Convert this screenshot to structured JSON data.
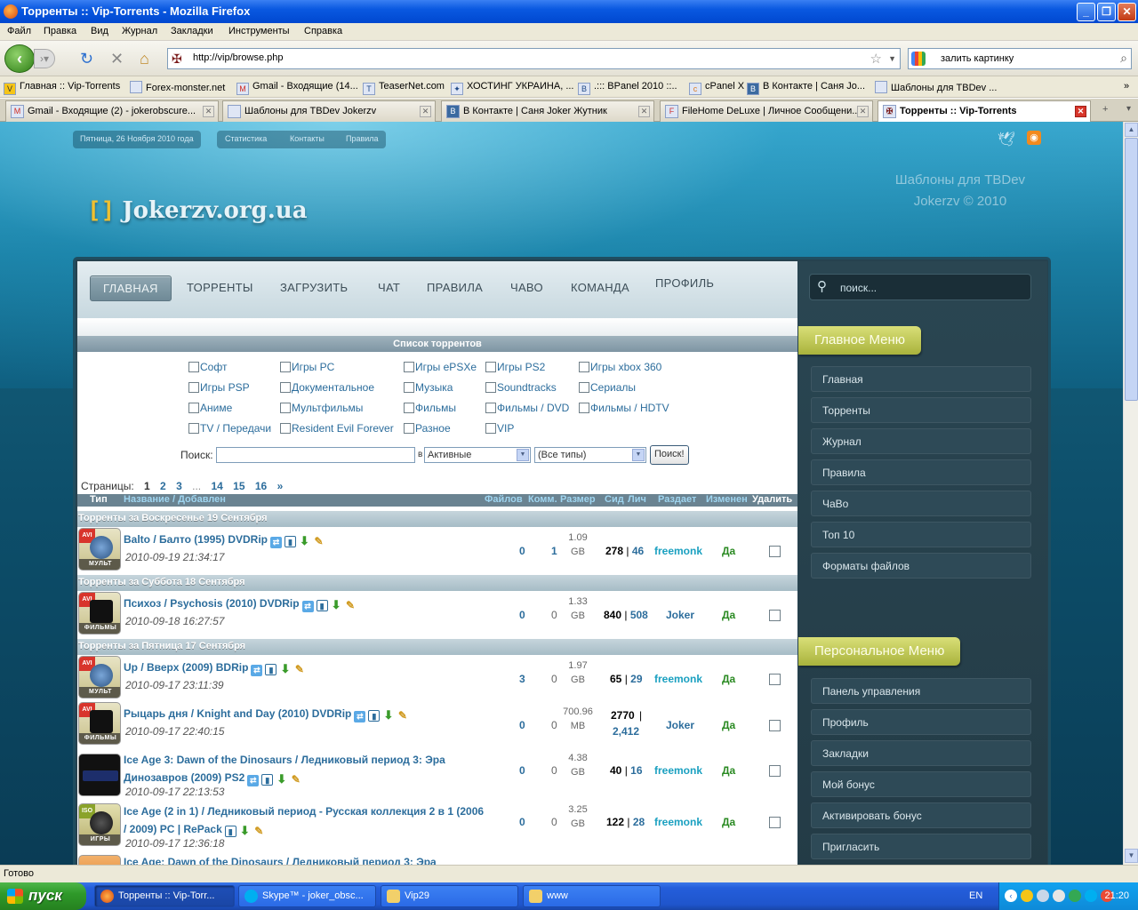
{
  "window": {
    "title": "Торренты :: Vip-Torrents - Mozilla Firefox"
  },
  "menu": [
    "Файл",
    "Правка",
    "Вид",
    "Журнал",
    "Закладки",
    "Инструменты",
    "Справка"
  ],
  "address": {
    "url": "http://vip/browse.php",
    "search_value": "залить картинку"
  },
  "bookmarks": [
    "Главная :: Vip-Torrents",
    "Forex-monster.net",
    "Gmail - Входящие (14...",
    "TeaserNet.com",
    "ХОСТИНГ УКРАИНА, ...",
    ".::: BPanel 2010 ::..",
    "cPanel X",
    "В Контакте | Саня Jo...",
    "Шаблоны для TBDev ..."
  ],
  "tabs": [
    {
      "label": "Gmail - Входящие (2) - jokerobscure..."
    },
    {
      "label": "Шаблоны для TBDev Jokerzv"
    },
    {
      "label": "В Контакте | Саня Joker Жутник"
    },
    {
      "label": "FileHome DeLuxe | Личное Сообщени..."
    },
    {
      "label": "Торренты :: Vip-Torrents"
    }
  ],
  "site": {
    "date": "Пятница, 26 Ноября 2010 года",
    "links": [
      "Статистика",
      "Контакты",
      "Правила"
    ],
    "logo": "Jokerzv.org.ua",
    "tagline1": "Шаблоны для TBDev",
    "tagline2": "Jokerzv © 2010"
  },
  "nav": [
    "ГЛАВНАЯ",
    "ТОРРЕНТЫ",
    "ЗАГРУЗИТЬ",
    "ЧАТ",
    "ПРАВИЛА",
    "ЧАВО",
    "КОМАНДА",
    "ПРОФИЛЬ"
  ],
  "list_title": "Список торрентов",
  "categories": [
    "Софт",
    "Игры PC",
    "Игры ePSXe",
    "Игры PS2",
    "Игры xbox 360",
    "Игры PSP",
    "Документальное",
    "Музыка",
    "Soundtracks",
    "Сериалы",
    "Аниме",
    "Мультфильмы",
    "Фильмы",
    "Фильмы / DVD",
    "Фильмы / HDTV",
    "TV / Передачи",
    "Resident Evil Forever",
    "Разное",
    "VIP"
  ],
  "search": {
    "label": "Поиск:",
    "in": "в",
    "status": "Активные",
    "types": "(Все типы)",
    "button": "Поиск!"
  },
  "pages": {
    "label": "Страницы:",
    "items": [
      "1",
      "2",
      "3",
      "...",
      "14",
      "15",
      "16",
      "»"
    ]
  },
  "columns": {
    "type": "Тип",
    "name": "Название / Добавлен",
    "files": "Файлов",
    "comm": "Комм.",
    "size": "Размер",
    "seed": "Сид",
    "leech": "Лич",
    "uploader": "Раздает",
    "changed": "Изменен",
    "delete": "Удалить"
  },
  "days": [
    "Торренты за Воскресенье 19 Сентября",
    "Торренты за Суббота 18 Сентября",
    "Торренты за Пятница 17 Сентября"
  ],
  "torrents": [
    {
      "name": "Balto / Балто (1995) DVDRip",
      "date": "2010-09-19 21:34:17",
      "files": "0",
      "comm": "1",
      "size1": "1.09",
      "size2": "GB",
      "seed": "278",
      "leech": "46",
      "uploader": "freemonk",
      "changed": "Да",
      "tag": "AVI",
      "label": "МУЛЬТ"
    },
    {
      "name": "Психоз / Psychosis (2010) DVDRip",
      "date": "2010-09-18 16:27:57",
      "files": "0",
      "comm": "0",
      "size1": "1.33",
      "size2": "GB",
      "seed": "840",
      "leech": "508",
      "uploader": "Joker",
      "changed": "Да",
      "tag": "AVI",
      "label": "ФИЛЬМЫ"
    },
    {
      "name": "Up / Вверх (2009) BDRip",
      "date": "2010-09-17 23:11:39",
      "files": "3",
      "comm": "0",
      "size1": "1.97",
      "size2": "GB",
      "seed": "65",
      "leech": "29",
      "uploader": "freemonk",
      "changed": "Да",
      "tag": "AVI",
      "label": "МУЛЬТ"
    },
    {
      "name": "Рыцарь дня / Knight and Day (2010) DVDRip",
      "date": "2010-09-17 22:40:15",
      "files": "0",
      "comm": "0",
      "size1": "700.96",
      "size2": "MB",
      "seed": "2770",
      "leech": "2,412",
      "uploader": "Joker",
      "changed": "Да",
      "tag": "AVI",
      "label": "ФИЛЬМЫ"
    },
    {
      "name": "Ice Age 3: Dawn of the Dinosaurs / Ледниковый период 3: Эра",
      "name2": "Динозавров (2009) PS2",
      "date": "2010-09-17 22:13:53",
      "files": "0",
      "comm": "0",
      "size1": "4.38",
      "size2": "GB",
      "seed": "40",
      "leech": "16",
      "uploader": "freemonk",
      "changed": "Да"
    },
    {
      "name": "Ice Age (2 in 1) / Ледниковый период - Русская коллекция 2 в 1 (2006",
      "name2": "/ 2009) PC | RePack",
      "date": "2010-09-17 12:36:18",
      "files": "0",
      "comm": "0",
      "size1": "3.25",
      "size2": "GB",
      "seed": "122",
      "leech": "28",
      "uploader": "freemonk",
      "changed": "Да",
      "tag": "ISO",
      "label": "ИГРЫ"
    },
    {
      "name": "Ice Age: Dawn of the Dinosaurs / Ледниковый период 3: Эра"
    }
  ],
  "sidebar": {
    "search_placeholder": "поиск...",
    "main_title": "Главное Меню",
    "main": [
      "Главная",
      "Торренты",
      "Журнал",
      "Правила",
      "ЧаВо",
      "Топ 10",
      "Форматы файлов"
    ],
    "personal_title": "Персональное Меню",
    "personal": [
      "Панель управления",
      "Профиль",
      "Закладки",
      "Мой бонус",
      "Активировать бонус",
      "Пригласить"
    ]
  },
  "status": "Готово",
  "taskbar": {
    "start": "пуск",
    "items": [
      "Торренты :: Vip-Torr...",
      "Skype™ - joker_obsc...",
      "Vip29",
      "www"
    ],
    "lang": "EN",
    "clock": "21:20"
  }
}
